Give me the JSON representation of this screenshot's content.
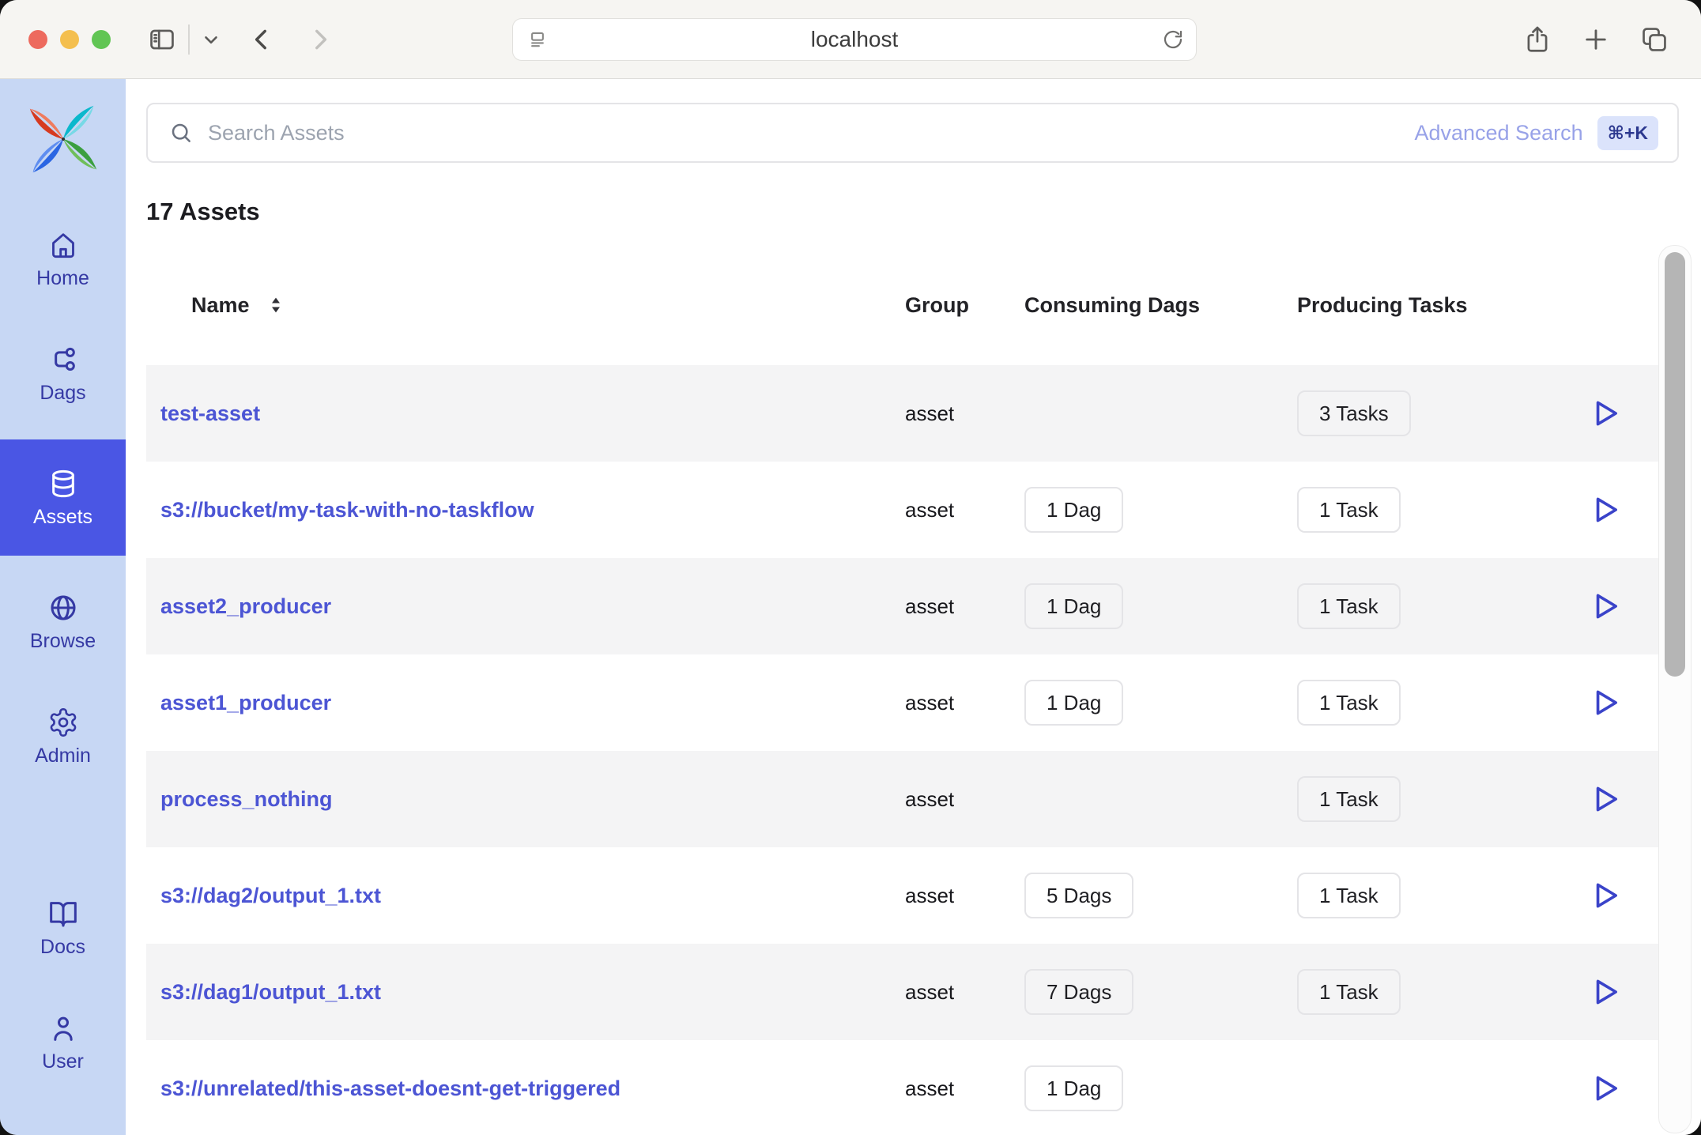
{
  "browser": {
    "url": "localhost",
    "toolbar_icons_left": [
      "sidebar-toggle-icon",
      "chevron-down-icon",
      "back-icon",
      "forward-icon"
    ],
    "url_field_icons": [
      "reader-view-icon",
      "reload-icon"
    ],
    "toolbar_icons_right": [
      "share-icon",
      "new-tab-icon",
      "tab-overview-icon"
    ]
  },
  "sidebar": {
    "logo_icon": "airflow-pinwheel-logo",
    "items": [
      {
        "id": "home",
        "label": "Home",
        "icon": "home-icon",
        "active": false
      },
      {
        "id": "dags",
        "label": "Dags",
        "icon": "dag-icon",
        "active": false
      },
      {
        "id": "assets",
        "label": "Assets",
        "icon": "database-icon",
        "active": true
      },
      {
        "id": "browse",
        "label": "Browse",
        "icon": "globe-icon",
        "active": false
      },
      {
        "id": "admin",
        "label": "Admin",
        "icon": "gear-icon",
        "active": false
      },
      {
        "id": "docs",
        "label": "Docs",
        "icon": "book-icon",
        "active": false,
        "pinned_bottom": true
      },
      {
        "id": "user",
        "label": "User",
        "icon": "user-icon",
        "active": false,
        "pinned_bottom": true
      }
    ]
  },
  "search": {
    "placeholder": "Search Assets",
    "icon": "search-icon",
    "advanced_label": "Advanced Search",
    "shortcut": "⌘+K"
  },
  "page": {
    "heading": "17 Assets"
  },
  "table": {
    "columns": [
      "Name",
      "Group",
      "Consuming Dags",
      "Producing Tasks"
    ],
    "sort_icon": "sort-updown-icon",
    "row_action_icon": "play-icon",
    "rows": [
      {
        "name": "test-asset",
        "group": "asset",
        "consuming": null,
        "producing": "3 Tasks"
      },
      {
        "name": "s3://bucket/my-task-with-no-taskflow",
        "group": "asset",
        "consuming": "1 Dag",
        "producing": "1 Task"
      },
      {
        "name": "asset2_producer",
        "group": "asset",
        "consuming": "1 Dag",
        "producing": "1 Task"
      },
      {
        "name": "asset1_producer",
        "group": "asset",
        "consuming": "1 Dag",
        "producing": "1 Task"
      },
      {
        "name": "process_nothing",
        "group": "asset",
        "consuming": null,
        "producing": "1 Task"
      },
      {
        "name": "s3://dag2/output_1.txt",
        "group": "asset",
        "consuming": "5 Dags",
        "producing": "1 Task"
      },
      {
        "name": "s3://dag1/output_1.txt",
        "group": "asset",
        "consuming": "7 Dags",
        "producing": "1 Task"
      },
      {
        "name": "s3://unrelated/this-asset-doesnt-get-triggered",
        "group": "asset",
        "consuming": "1 Dag",
        "producing": null
      }
    ]
  },
  "colors": {
    "accent_selected": "#4a56e4",
    "link": "#4c55d4",
    "sidebar_bg": "#c7d7f4",
    "sidebar_fg": "#3539a4",
    "row_stripe": "#f4f4f5",
    "kbd_bg": "#dbe3fb",
    "kbd_fg": "#2c388f",
    "traffic_red": "#ed6a5e",
    "traffic_yellow": "#f4bf4f",
    "traffic_green": "#61c554"
  }
}
